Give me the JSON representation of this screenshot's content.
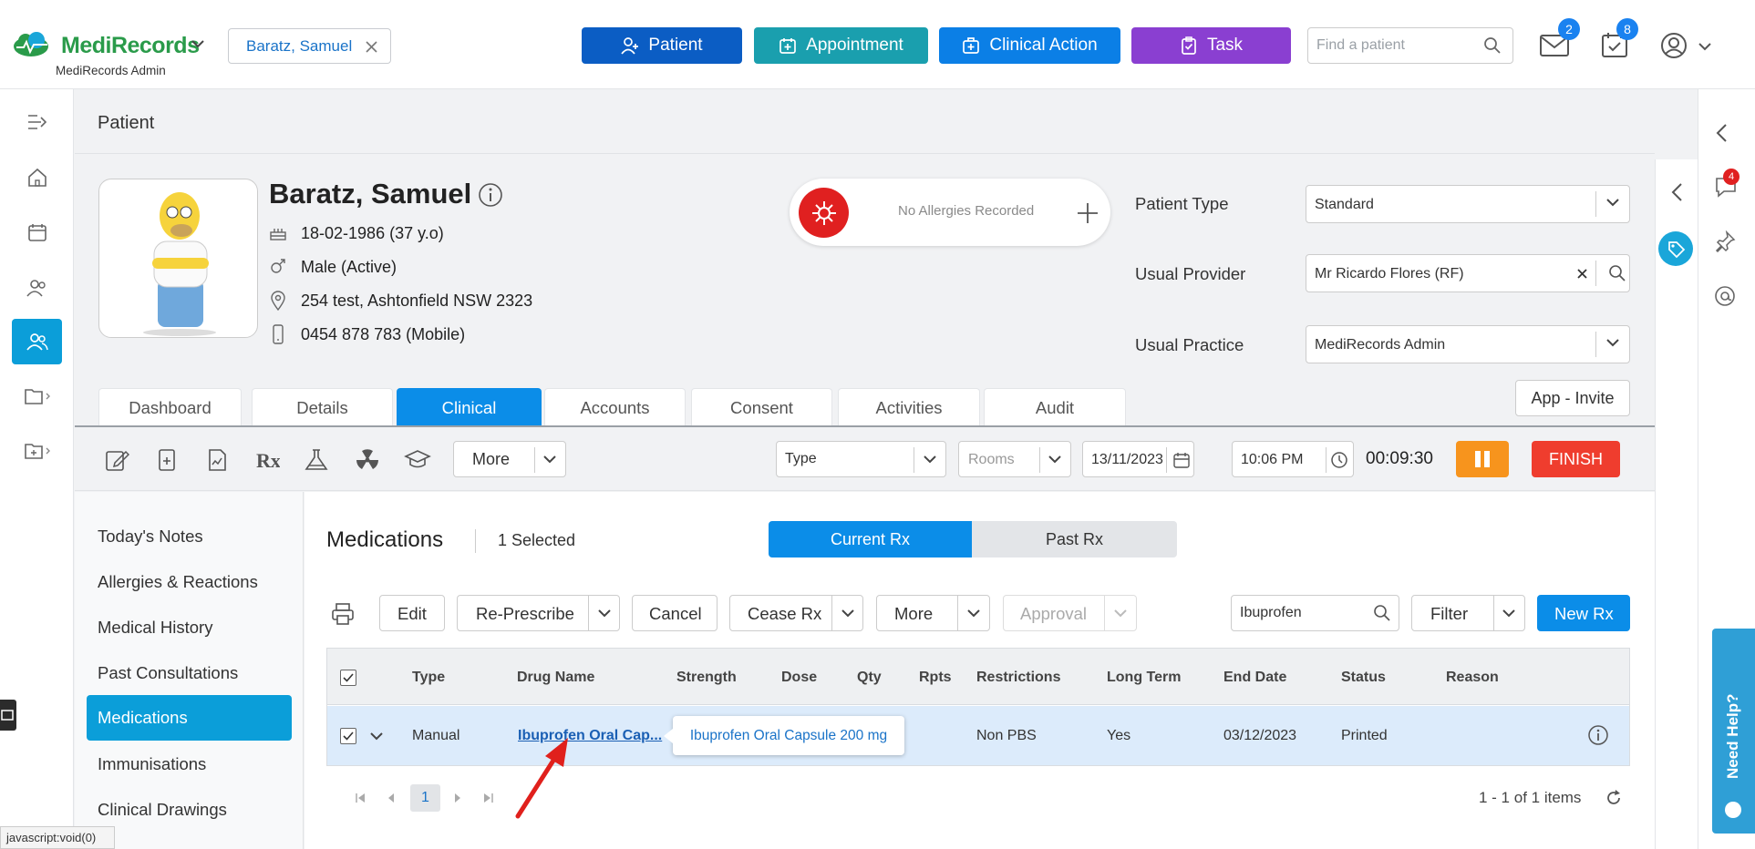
{
  "header": {
    "brand_name": "MediRecords",
    "brand_sub": "MediRecords Admin",
    "patient_chip": "Baratz, Samuel",
    "buttons": {
      "patient": "Patient",
      "appointment": "Appointment",
      "clinical_action": "Clinical Action",
      "task": "Task"
    },
    "button_colors": {
      "patient": "#0b5dc4",
      "appointment": "#1a9fae",
      "clinical_action": "#0b7fe6",
      "task": "#8a3fd1"
    },
    "search_placeholder": "Find a patient",
    "mail_count": "2",
    "tasks_count": "8"
  },
  "page": {
    "title": "Patient"
  },
  "patient": {
    "name": "Baratz, Samuel",
    "dob": "18-02-1986 (37 y.o)",
    "gender": "Male (Active)",
    "address": "254 test, Ashtonfield NSW 2323",
    "phone": "0454 878 783 (Mobile)",
    "allergies": "No Allergies Recorded"
  },
  "fields": {
    "patient_type_label": "Patient Type",
    "patient_type_value": "Standard",
    "usual_provider_label": "Usual Provider",
    "usual_provider_value": "Mr Ricardo Flores (RF)",
    "usual_practice_label": "Usual Practice",
    "usual_practice_value": "MediRecords Admin"
  },
  "tabs": [
    "Dashboard",
    "Details",
    "Clinical",
    "Accounts",
    "Consent",
    "Activities",
    "Audit"
  ],
  "active_tab": "Clinical",
  "app_invite": "App - Invite",
  "toolbar": {
    "more": "More",
    "type_placeholder": "Type",
    "rooms_placeholder": "Rooms",
    "date": "13/11/2023",
    "time": "10:06 PM",
    "timer": "00:09:30",
    "finish": "FINISH"
  },
  "clinical_menu": [
    "Today's Notes",
    "Allergies & Reactions",
    "Medical History",
    "Past Consultations",
    "Medications",
    "Immunisations",
    "Clinical Drawings"
  ],
  "active_menu": "Medications",
  "medications": {
    "title": "Medications",
    "selected": "1 Selected",
    "current_rx": "Current Rx",
    "past_rx": "Past Rx",
    "actions": {
      "edit": "Edit",
      "represcribe": "Re-Prescribe",
      "cancel": "Cancel",
      "cease": "Cease Rx",
      "more": "More",
      "approval": "Approval",
      "filter": "Filter",
      "new_rx": "New Rx"
    },
    "search_value": "Ibuprofen",
    "columns": [
      "Type",
      "Drug Name",
      "Strength",
      "Dose",
      "Qty",
      "Rpts",
      "Restrictions",
      "Long Term",
      "End Date",
      "Status",
      "Reason"
    ],
    "rows": [
      {
        "type": "Manual",
        "drug_name": "Ibuprofen Oral Cap...",
        "strength": "",
        "dose": "",
        "qty": "",
        "rpts": "",
        "restrictions": "Non PBS",
        "long_term": "Yes",
        "end_date": "03/12/2023",
        "status": "Printed",
        "reason": ""
      }
    ],
    "tooltip": "Ibuprofen Oral Capsule 200 mg",
    "page": "1",
    "page_summary": "1 - 1 of 1 items"
  },
  "status_bar": "javascript:void(0)",
  "need_help": "Need Help?",
  "notifications_count": "4"
}
